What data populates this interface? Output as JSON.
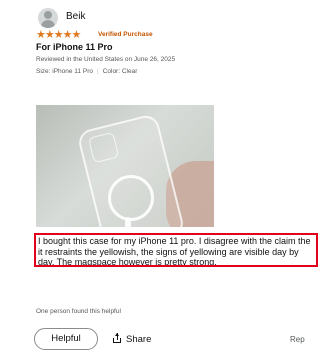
{
  "review": {
    "reviewer_name": "Beik",
    "stars": "★★★★★",
    "rating": 5,
    "badge": "Verified Purchase",
    "title": "For iPhone 11 Pro",
    "reviewed_in": "Reviewed in the United States on June 26, 2025",
    "size": "Size: iPhone 11 Pro",
    "color": "Color: Clear",
    "body": "I bought this case for my iPhone 11 pro. I disagree with the claim the it restraints the yellowish, the signs of yellowing are visible day by day. The magspace however is pretty strong.",
    "helpful_count": "One person found this helpful",
    "helpful_label": "Helpful",
    "share_label": "Share",
    "report_label": "Rep"
  },
  "colors": {
    "star": "#de7921",
    "verified": "#c45500",
    "highlight_border": "#e3001b"
  },
  "icons": [
    "avatar-icon",
    "star-icon",
    "share-icon"
  ]
}
